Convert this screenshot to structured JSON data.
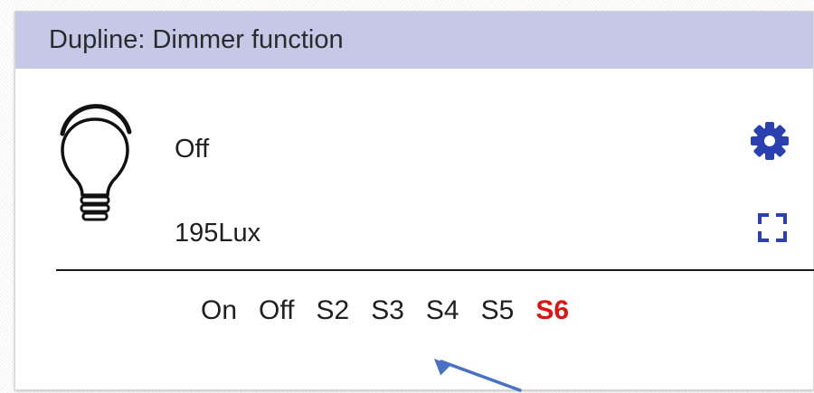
{
  "card": {
    "title": "Dupline: Dimmer function",
    "header_color": "#c5c8e6"
  },
  "device": {
    "icon": "light-bulb-icon",
    "status": "Off",
    "lux_reading": "195Lux"
  },
  "actions": {
    "settings_icon": "gear-icon",
    "fullscreen_icon": "fullscreen-icon",
    "accent_color": "#2a3fb0"
  },
  "scenes": {
    "items": [
      {
        "label": "On",
        "active": false
      },
      {
        "label": "Off",
        "active": false
      },
      {
        "label": "S2",
        "active": false
      },
      {
        "label": "S3",
        "active": false
      },
      {
        "label": "S4",
        "active": false
      },
      {
        "label": "S5",
        "active": false
      },
      {
        "label": "S6",
        "active": true
      }
    ],
    "active_color": "#e11212"
  },
  "annotation": {
    "icon": "pointer-arrow-icon",
    "color": "#4a72c4"
  }
}
